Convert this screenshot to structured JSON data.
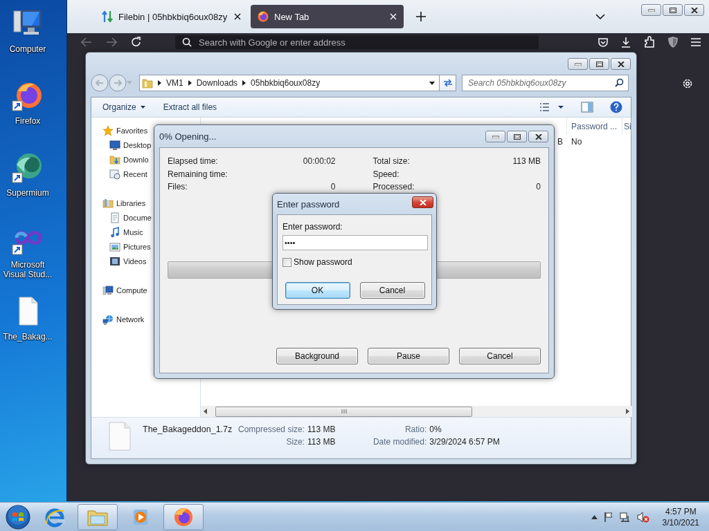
{
  "desktop_icons": [
    {
      "label": "Computer",
      "kind": "computer"
    },
    {
      "label": "Firefox",
      "kind": "firefox"
    },
    {
      "label": "Supermium",
      "kind": "supermium"
    },
    {
      "label": "Microsoft Visual Stud...",
      "kind": "studio"
    },
    {
      "label": "The_Bakag...",
      "kind": "file"
    }
  ],
  "browser": {
    "tabs": [
      {
        "label": "Filebin | 05hbkbiq6oux08zy",
        "kind": "filebin",
        "selected": false
      },
      {
        "label": "New Tab",
        "kind": "firefox",
        "selected": true
      }
    ],
    "address_placeholder": "Search with Google or enter address"
  },
  "explorer": {
    "breadcrumb": [
      "VM1",
      "Downloads",
      "05hbkbiq6oux08zy"
    ],
    "search_placeholder": "Search 05hbkbiq6oux08zy",
    "commands": [
      {
        "label": "Organize",
        "kind": "menu"
      },
      {
        "label": "Extract all files",
        "kind": "plain"
      }
    ],
    "nav": [
      {
        "label": "Favorites",
        "kind": "star",
        "children": [
          {
            "label": "Desktop",
            "kind": "desktop"
          },
          {
            "label": "Downlo",
            "kind": "downloads"
          },
          {
            "label": "Recent",
            "kind": "recent"
          }
        ]
      },
      {
        "label": "Libraries",
        "kind": "library",
        "children": [
          {
            "label": "Docume",
            "kind": "documents"
          },
          {
            "label": "Music",
            "kind": "music"
          },
          {
            "label": "Pictures",
            "kind": "pictures"
          },
          {
            "label": "Videos",
            "kind": "videos"
          }
        ]
      },
      {
        "label": "Compute",
        "kind": "computer"
      },
      {
        "label": "Network",
        "kind": "network"
      }
    ],
    "columns": [
      "Password ...",
      "Si"
    ],
    "row": [
      "B",
      "No"
    ],
    "details": {
      "name": "The_Bakageddon_1.7z",
      "fields": [
        {
          "label": "Compressed size:",
          "value": "113 MB"
        },
        {
          "label": "Size:",
          "value": "113 MB"
        }
      ],
      "fields_right": [
        {
          "label": "Ratio:",
          "value": "0%"
        },
        {
          "label": "Date modified:",
          "value": "3/29/2024 6:57 PM"
        }
      ]
    }
  },
  "progress_dialog": {
    "title": "0% Opening...",
    "stats": [
      {
        "label": "Elapsed time:",
        "value": "00:00:02"
      },
      {
        "label": "Remaining time:"
      },
      {
        "label": "Files:",
        "value": "0"
      }
    ],
    "stats_right": [
      {
        "label": "Total size:",
        "value": "113 MB"
      },
      {
        "label": "Speed:"
      },
      {
        "label": "Processed:",
        "value": "0"
      }
    ],
    "level": 0,
    "buttons": [
      "Background",
      "Pause",
      "Cancel"
    ]
  },
  "password_dialog": {
    "title": "Enter password",
    "prompt": "Enter password:",
    "value": "••••",
    "show_password": {
      "label": "Show password",
      "checked": false
    },
    "buttons": [
      {
        "label": "OK",
        "default": true
      },
      {
        "label": "Cancel",
        "default": false
      }
    ]
  },
  "taskbar": {
    "items": [
      {
        "kind": "ie",
        "open": false
      },
      {
        "kind": "explorer",
        "open": true
      },
      {
        "kind": "media",
        "open": false
      },
      {
        "kind": "firefox",
        "open": true
      }
    ],
    "time": "4:57 PM",
    "date": "3/10/2021"
  }
}
